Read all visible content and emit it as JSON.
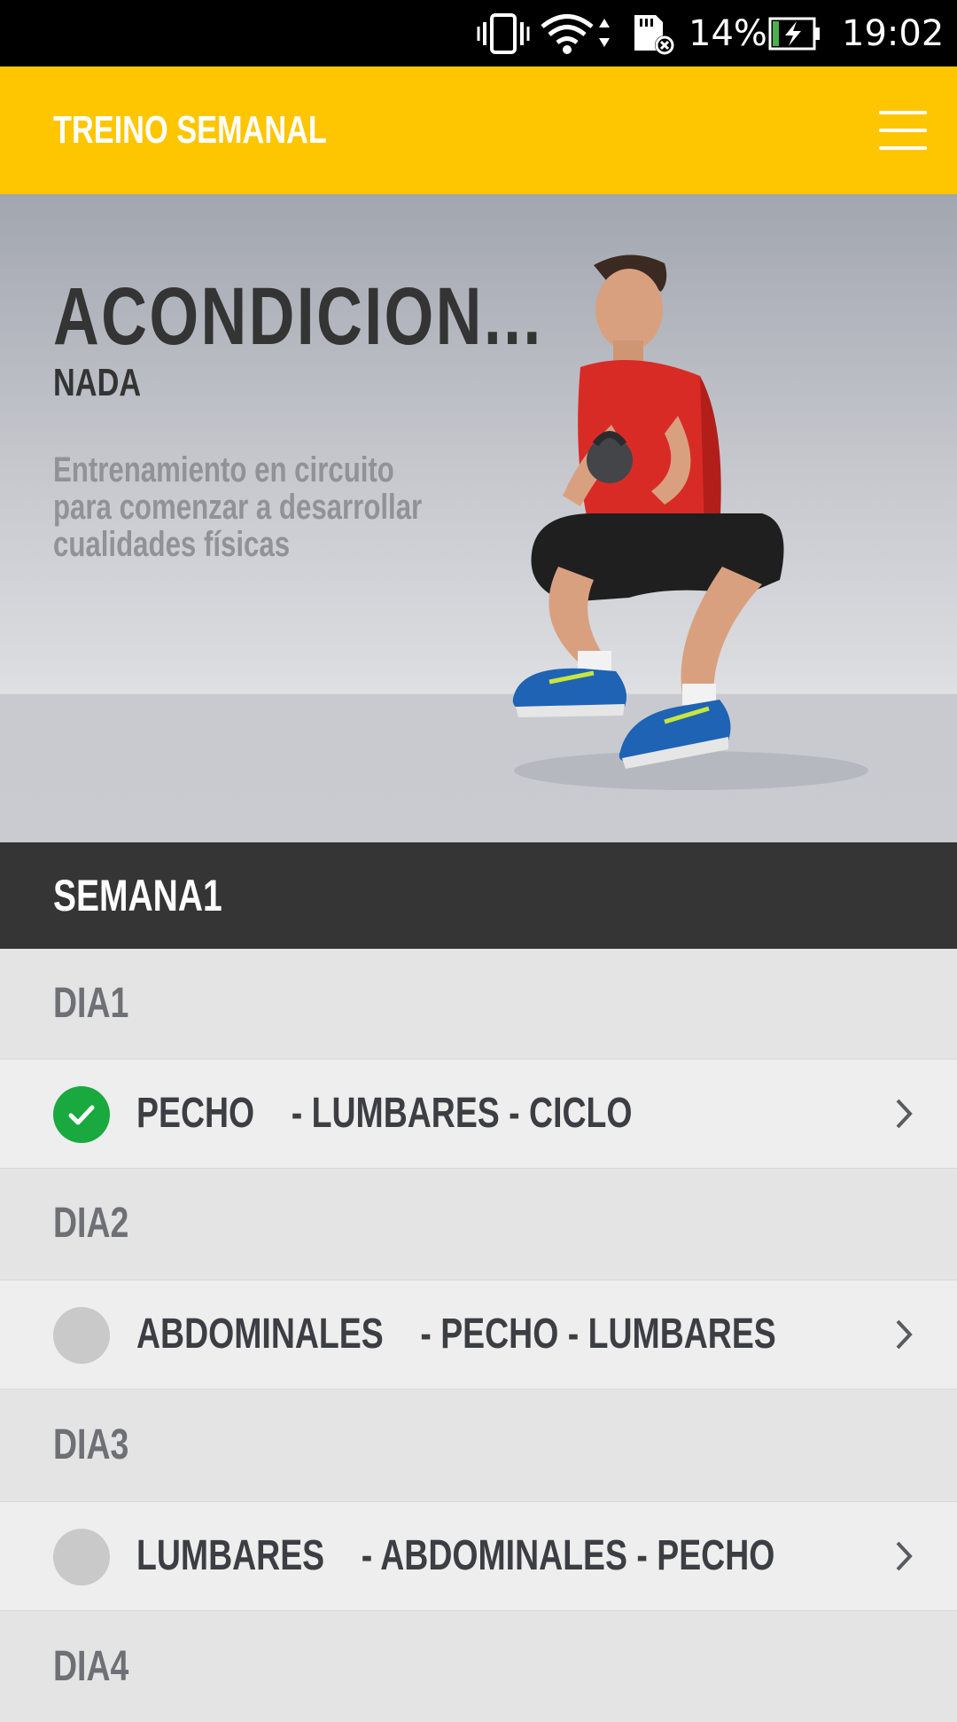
{
  "status_bar": {
    "battery": "14%",
    "time": "19:02"
  },
  "app_bar": {
    "title": "TREINO SEMANAL"
  },
  "hero": {
    "title": "ACONDICION...",
    "subtitle": "NADA",
    "description": "Entrenamiento en circuito para comenzar a desarrollar cualidades físicas"
  },
  "week": {
    "label": "SEMANA1"
  },
  "days": [
    {
      "label": "DIA1",
      "workout": {
        "part1": "PECHO",
        "part2": "- LUMBARES - CICLO",
        "completed": true
      }
    },
    {
      "label": "DIA2",
      "workout": {
        "part1": "ABDOMINALES",
        "part2": "- PECHO - LUMBARES",
        "completed": false
      }
    },
    {
      "label": "DIA3",
      "workout": {
        "part1": "LUMBARES",
        "part2": "- ABDOMINALES - PECHO",
        "completed": false
      }
    },
    {
      "label": "DIA4"
    }
  ],
  "colors": {
    "accent": "#fec600",
    "completed": "#19a93f",
    "pending": "#c9c9c9",
    "dark_header": "#353535"
  }
}
